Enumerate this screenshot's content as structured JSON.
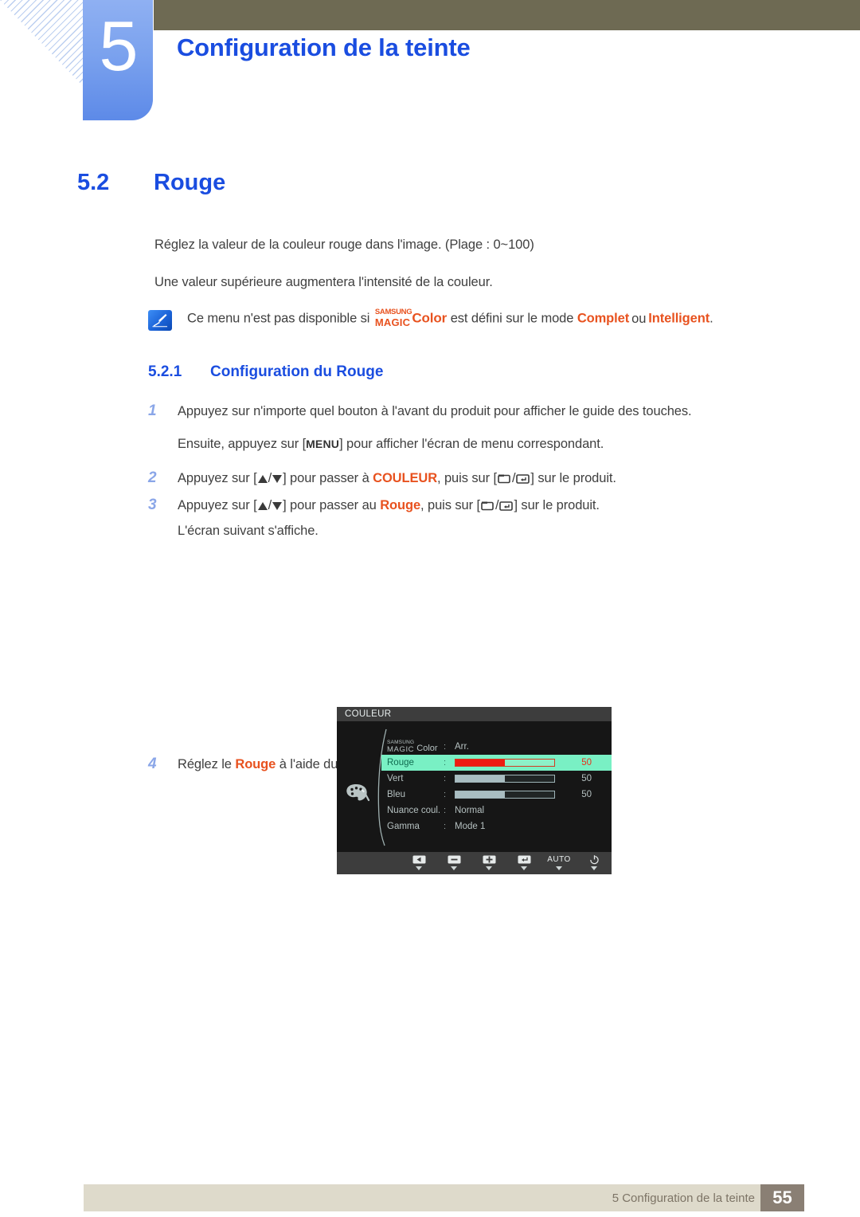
{
  "header": {
    "chapter_number": "5",
    "chapter_title": "Configuration de la teinte"
  },
  "section": {
    "number": "5.2",
    "title": "Rouge",
    "paragraph_1": "Réglez la valeur de la couleur rouge dans l'image. (Plage : 0~100)",
    "paragraph_2": "Une valeur supérieure augmentera l'intensité de la couleur."
  },
  "note": {
    "icon": "note-pen-icon",
    "text_before": "Ce menu n'est pas disponible si",
    "magic_line1": "SAMSUNG",
    "magic_line2": "MAGIC",
    "magic_color": "Color",
    "text_middle": "est défini sur le mode",
    "mode_1": "Complet",
    "text_or": "ou",
    "mode_2": "Intelligent",
    "text_end": "."
  },
  "subsection": {
    "number": "5.2.1",
    "title": "Configuration du Rouge"
  },
  "steps": [
    {
      "number": "1",
      "text": "Appuyez sur n'importe quel bouton à l'avant du produit pour afficher le guide des touches.",
      "sub_text_before": "Ensuite, appuyez sur [",
      "sub_key": "MENU",
      "sub_text_after": "] pour afficher l'écran de menu correspondant."
    },
    {
      "number": "2",
      "prefix": "Appuyez sur [",
      "mid": "] pour passer à",
      "target": "COULEUR",
      "mid2": ", puis sur [",
      "suffix": "] sur le produit."
    },
    {
      "number": "3",
      "prefix": "Appuyez sur [",
      "mid": "] pour passer au",
      "target": "Rouge",
      "mid2": ", puis sur [",
      "suffix": "] sur le produit.",
      "sub_text": "L'écran suivant s'affiche."
    },
    {
      "number": "4",
      "prefix": "Réglez le",
      "target": "Rouge",
      "suffix_before": "à l'aide du bouton [",
      "suffix_after": "]."
    }
  ],
  "osd": {
    "title": "COULEUR",
    "palette_icon": "palette-icon",
    "rows": [
      {
        "label_line1": "SAMSUNG",
        "label_line2": "MAGIC",
        "label_suffix": "Color",
        "value": "Arr.",
        "type": "text",
        "selected": false
      },
      {
        "label": "Rouge",
        "value": "50",
        "type": "slider",
        "percent": 50,
        "selected": true
      },
      {
        "label": "Vert",
        "value": "50",
        "type": "slider",
        "percent": 50,
        "selected": false
      },
      {
        "label": "Bleu",
        "value": "50",
        "type": "slider",
        "percent": 50,
        "selected": false
      },
      {
        "label": "Nuance coul.",
        "value": "Normal",
        "type": "text",
        "selected": false
      },
      {
        "label": "Gamma",
        "value": "Mode 1",
        "type": "text",
        "selected": false
      }
    ],
    "buttons": [
      {
        "name": "left-arrow-button",
        "glyph": "◀"
      },
      {
        "name": "minus-button",
        "glyph": "−"
      },
      {
        "name": "plus-button",
        "glyph": "+"
      },
      {
        "name": "enter-button",
        "glyph": "↵"
      },
      {
        "name": "auto-button",
        "label": "AUTO"
      },
      {
        "name": "power-button",
        "glyph": "⏻"
      }
    ],
    "colors": {
      "selected_highlight": "#79f0c4",
      "slider_red": "#ee1b11",
      "slider_gray": "#a9bdc1"
    }
  },
  "footer": {
    "text": "5 Configuration de la teinte",
    "page": "55"
  }
}
